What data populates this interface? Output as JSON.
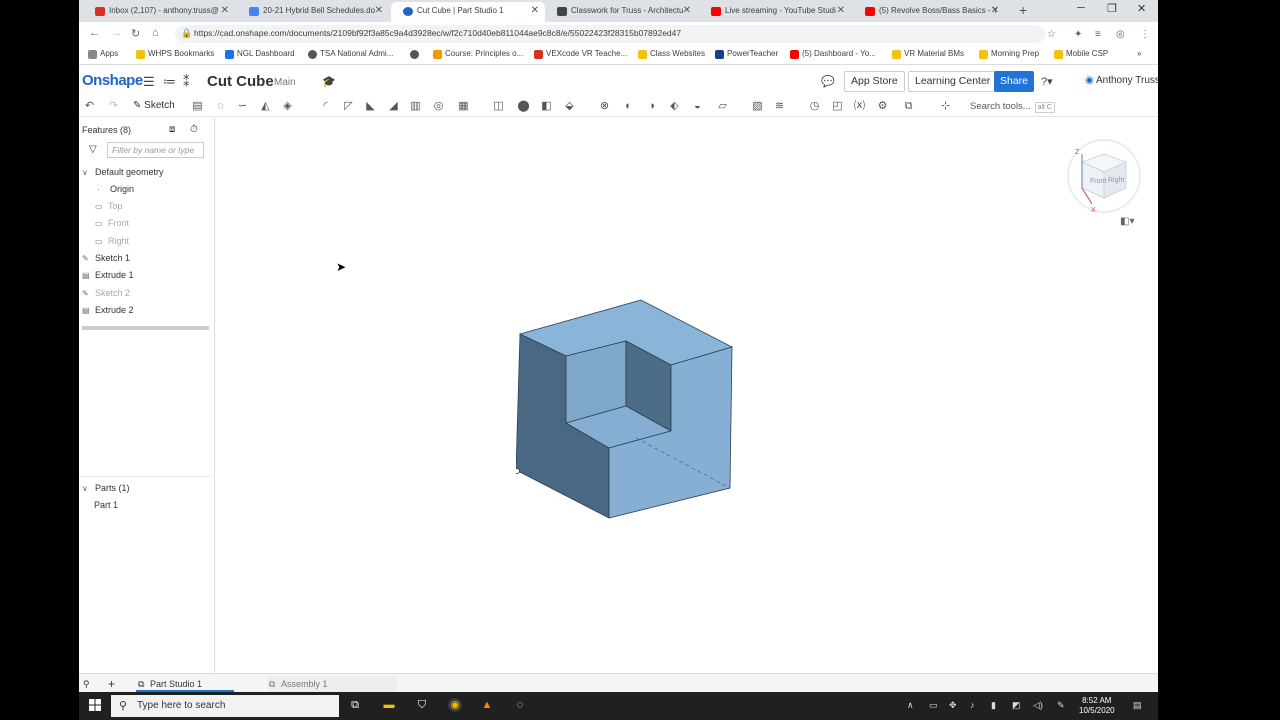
{
  "browser": {
    "tabs": [
      {
        "title": "Inbox (2,107) - anthony.truss@",
        "color": "#d93025",
        "active": false
      },
      {
        "title": "20-21 Hybrid Bell Schedules.do",
        "color": "#4285f4",
        "active": false
      },
      {
        "title": "Cut Cube | Part Studio 1",
        "color": "#1f66c4",
        "active": true
      },
      {
        "title": "Classwork for Truss - Architectu",
        "color": "#444444",
        "active": false
      },
      {
        "title": "Live streaming - YouTube Studi",
        "color": "#ff0000",
        "active": false
      },
      {
        "title": "(5) Revolve Boss/Bass Basics - Y",
        "color": "#ff0000",
        "active": false
      }
    ],
    "url": "https://cad.onshape.com/documents/2109bf92f3a85c9a4d3928ec/w/f2c710d40eb811044ae9c8c8/e/55022423f28315b07892ed47",
    "bookmarks": [
      {
        "label": "Apps",
        "color": "#888888"
      },
      {
        "label": "WHPS Bookmarks",
        "color": "#f4c20d"
      },
      {
        "label": "NGL Dashboard",
        "color": "#1a73e8"
      },
      {
        "label": "TSA National Admi...",
        "color": "#555555"
      },
      {
        "label": "",
        "color": "#555555"
      },
      {
        "label": "Course: Principles o...",
        "color": "#f29900"
      },
      {
        "label": "VEXcode VR Teache...",
        "color": "#d93025"
      },
      {
        "label": "Class Websites",
        "color": "#f4c20d"
      },
      {
        "label": "PowerTeacher",
        "color": "#1a3d8f"
      },
      {
        "label": "(5) Dashboard - Yo...",
        "color": "#ff0000"
      },
      {
        "label": "VR Material BMs",
        "color": "#f4c20d"
      },
      {
        "label": "Morning Prep",
        "color": "#f4c20d"
      },
      {
        "label": "Mobile CSP",
        "color": "#f4c20d"
      }
    ]
  },
  "onshape": {
    "logo": "Onshape",
    "doc_title": "Cut Cube",
    "branch": "Main",
    "app_store": "App Store",
    "learning_center": "Learning Center",
    "share": "Share",
    "user": "Anthony Truss",
    "sketch_label": "Sketch",
    "search_tools": "Search tools...",
    "search_shortcut": "alt C"
  },
  "features": {
    "header": "Features (8)",
    "filter_placeholder": "Filter by name or type",
    "default_geometry": "Default geometry",
    "items": [
      {
        "label": "Origin",
        "dim": false
      },
      {
        "label": "Top",
        "dim": true
      },
      {
        "label": "Front",
        "dim": true
      },
      {
        "label": "Right",
        "dim": true
      },
      {
        "label": "Sketch 1",
        "dim": false
      },
      {
        "label": "Extrude 1",
        "dim": false
      },
      {
        "label": "Sketch 2",
        "dim": true
      },
      {
        "label": "Extrude 2",
        "dim": false
      }
    ],
    "parts_header": "Parts (1)",
    "parts": [
      "Part 1"
    ]
  },
  "viewcube": {
    "top": "Z",
    "front": "Front",
    "right": "Right",
    "x": "X"
  },
  "bottom_tabs": {
    "part_studio": "Part Studio 1",
    "assembly": "Assembly 1"
  },
  "taskbar": {
    "search": "Type here to search",
    "time": "8:52 AM",
    "date": "10/5/2020"
  }
}
